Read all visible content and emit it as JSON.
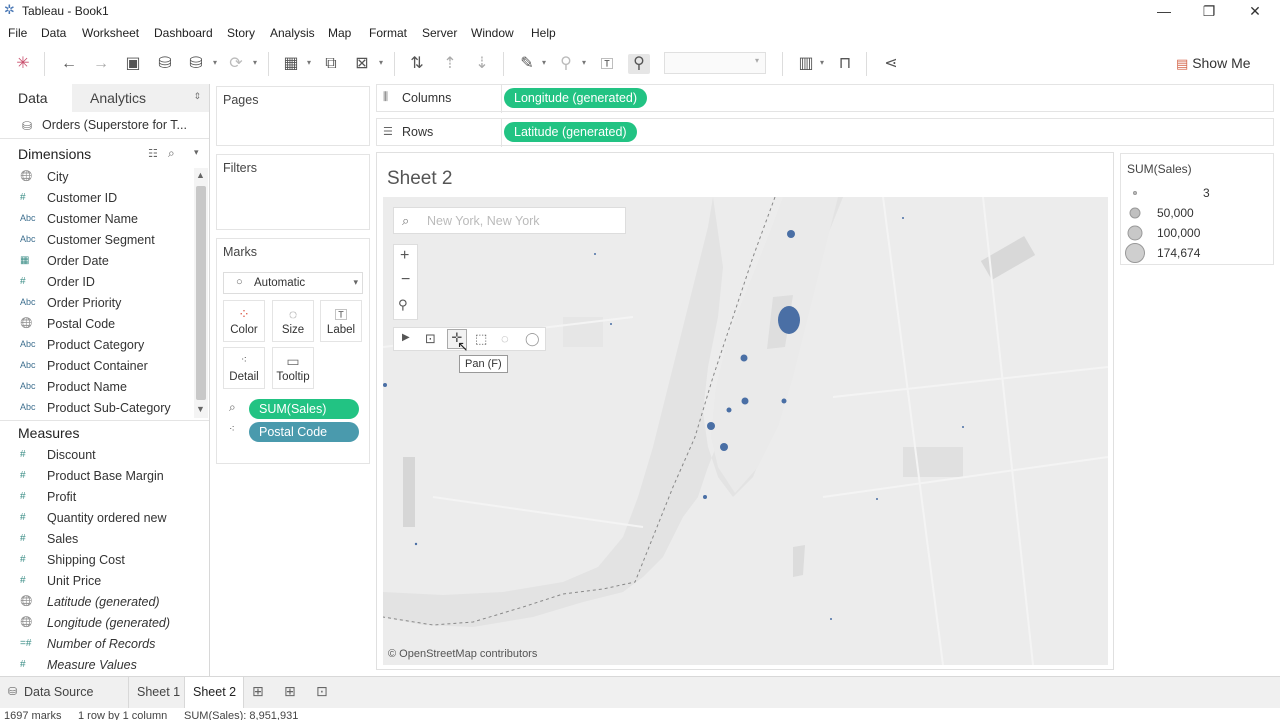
{
  "window": {
    "title": "Tableau - Book1"
  },
  "menu": [
    "File",
    "Data",
    "Worksheet",
    "Dashboard",
    "Story",
    "Analysis",
    "Map",
    "Format",
    "Server",
    "Window",
    "Help"
  ],
  "toolbar": {
    "show_me": "Show Me"
  },
  "datapane": {
    "tab_data": "Data",
    "tab_analytics": "Analytics",
    "source": "Orders (Superstore for T...",
    "dimensions_label": "Dimensions",
    "measures_label": "Measures",
    "dimensions": [
      {
        "icon": "globe",
        "name": "City"
      },
      {
        "icon": "#",
        "name": "Customer ID"
      },
      {
        "icon": "Abc",
        "name": "Customer Name"
      },
      {
        "icon": "Abc",
        "name": "Customer Segment"
      },
      {
        "icon": "calendar",
        "name": "Order Date"
      },
      {
        "icon": "#",
        "name": "Order ID"
      },
      {
        "icon": "Abc",
        "name": "Order Priority"
      },
      {
        "icon": "globe",
        "name": "Postal Code"
      },
      {
        "icon": "Abc",
        "name": "Product Category"
      },
      {
        "icon": "Abc",
        "name": "Product Container"
      },
      {
        "icon": "Abc",
        "name": "Product Name"
      },
      {
        "icon": "Abc",
        "name": "Product Sub-Category"
      }
    ],
    "measures": [
      {
        "icon": "#",
        "name": "Discount"
      },
      {
        "icon": "#",
        "name": "Product Base Margin"
      },
      {
        "icon": "#",
        "name": "Profit"
      },
      {
        "icon": "#",
        "name": "Quantity ordered new"
      },
      {
        "icon": "#",
        "name": "Sales"
      },
      {
        "icon": "#",
        "name": "Shipping Cost"
      },
      {
        "icon": "#",
        "name": "Unit Price"
      },
      {
        "icon": "globe",
        "name": "Latitude (generated)"
      },
      {
        "icon": "globe",
        "name": "Longitude (generated)"
      },
      {
        "icon": "=#",
        "name": "Number of Records"
      },
      {
        "icon": "#",
        "name": "Measure Values"
      }
    ]
  },
  "cards": {
    "pages": "Pages",
    "filters": "Filters",
    "marks": "Marks",
    "mark_type": "Automatic",
    "mark_buttons": [
      "Color",
      "Size",
      "Label",
      "Detail",
      "Tooltip"
    ],
    "mark_pills": [
      "SUM(Sales)",
      "Postal Code"
    ]
  },
  "shelves": {
    "columns_label": "Columns",
    "rows_label": "Rows",
    "columns_pill": "Longitude (generated)",
    "rows_pill": "Latitude (generated)"
  },
  "view": {
    "sheet_title": "Sheet 2",
    "search_placeholder": "New York, New York",
    "tooltip": "Pan (F)",
    "attribution": "© OpenStreetMap contributors"
  },
  "legend": {
    "title": "SUM(Sales)",
    "items": [
      "3",
      "50,000",
      "100,000",
      "174,674"
    ]
  },
  "bottom": {
    "data_source": "Data Source",
    "sheets": [
      "Sheet 1",
      "Sheet 2"
    ],
    "active_sheet": "Sheet 2"
  },
  "status": {
    "marks": "1697 marks",
    "layout": "1 row by 1 column",
    "sum": "SUM(Sales): 8,951,931"
  },
  "colors": {
    "accent_green": "#22c383",
    "pill_blue": "#4a9aad",
    "mark_blue": "#4a6fa5"
  }
}
